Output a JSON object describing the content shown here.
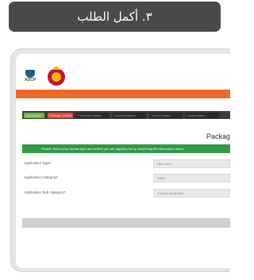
{
  "banner": {
    "step_title": "٣. أكمل الطلب"
  },
  "header": {
    "logo_text": "ADCP"
  },
  "tabs": [
    {
      "label": "Application"
    },
    {
      "label": "Package Details"
    },
    {
      "label": "Personal Details"
    },
    {
      "label": "Documentation"
    },
    {
      "label": "Travel Details"
    },
    {
      "label": "Confirmation"
    }
  ],
  "page": {
    "title": "Packag",
    "notice": "Please: Select your license type and vehicle you are applying for by completing the information below"
  },
  "form": {
    "fields": [
      {
        "label": "Application Type*",
        "value": "New Card"
      },
      {
        "label": "Application Category*",
        "value": "Visitor"
      },
      {
        "label": "Application Sub Category*",
        "value": "Choose Applicable"
      }
    ]
  },
  "colors": {
    "accent": "#f06a2a",
    "notice": "#2e9b44",
    "banner": "#4a4a4a"
  }
}
